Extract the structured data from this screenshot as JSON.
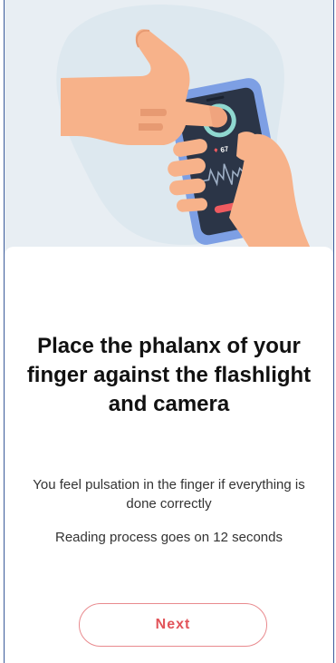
{
  "illustration": {
    "icon": "finger-on-phone-illustration",
    "heart_rate_value": "67",
    "colors": {
      "background": "#e8eef3",
      "skin": "#f7b28a",
      "skin_shadow": "#e79a72",
      "phone_frame": "#7d9fe4",
      "phone_screen": "#2b3547",
      "ring": "#8fd8d0",
      "button": "#ef5b60"
    }
  },
  "content": {
    "title": "Place the phalanx of your finger against the flashlight and camera",
    "description": "You feel pulsation in the finger if everything is done correctly",
    "reading_process": "Reading process goes on 12 seconds"
  },
  "actions": {
    "next_label": "Next"
  }
}
